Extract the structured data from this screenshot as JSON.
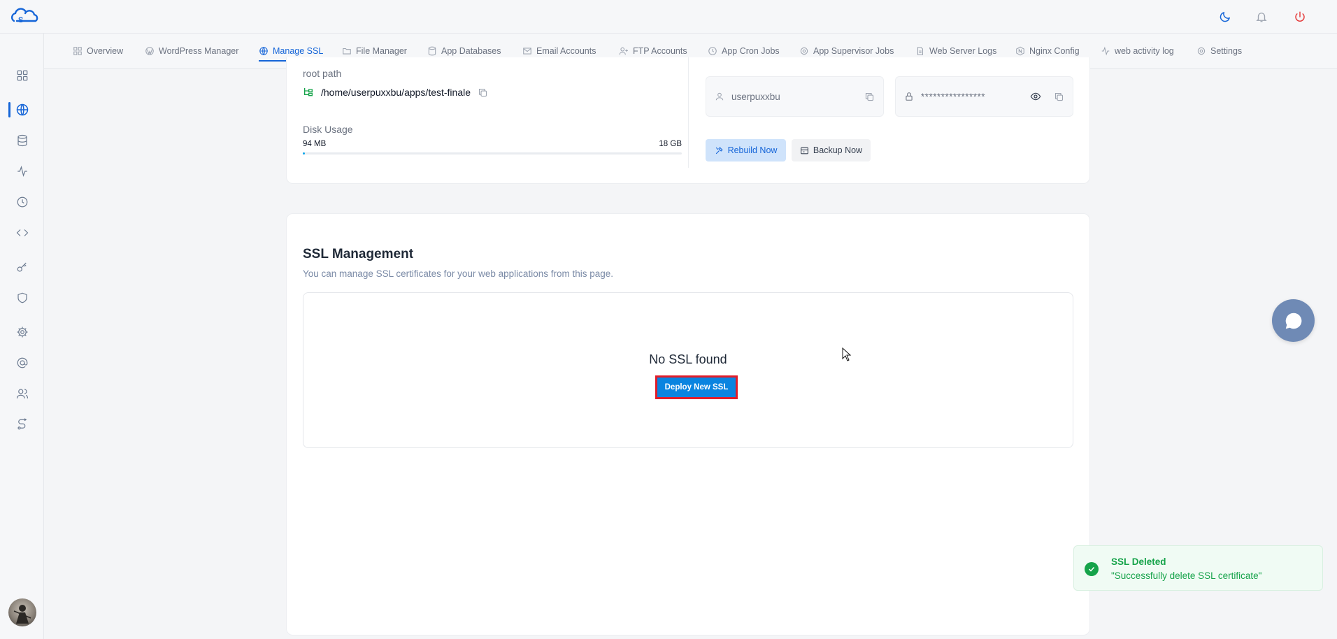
{
  "topbar": {
    "logo_icon": "cloud-logo-icon",
    "theme_icon": "moon-icon",
    "notification_icon": "bell-icon",
    "power_icon": "power-icon",
    "colors": {
      "accent": "#1565d8",
      "power": "#e53e3e"
    }
  },
  "sidebar": {
    "items": [
      {
        "icon": "dashboard-icon"
      },
      {
        "icon": "globe-icon",
        "active": true
      },
      {
        "icon": "database-icon"
      },
      {
        "icon": "activity-icon"
      },
      {
        "icon": "clock-icon"
      },
      {
        "icon": "code-icon"
      },
      {
        "icon": "key-icon"
      },
      {
        "icon": "shield-icon"
      },
      {
        "icon": "settings-gear-icon"
      },
      {
        "icon": "at-sign-icon"
      },
      {
        "icon": "users-icon"
      },
      {
        "icon": "route-icon"
      }
    ]
  },
  "tabs": [
    {
      "label": "Overview",
      "icon": "grid-icon"
    },
    {
      "label": "WordPress Manager",
      "icon": "wordpress-icon"
    },
    {
      "label": "Manage SSL",
      "icon": "globe-icon",
      "active": true
    },
    {
      "label": "File Manager",
      "icon": "folder-icon"
    },
    {
      "label": "App Databases",
      "icon": "database-icon"
    },
    {
      "label": "Email Accounts",
      "icon": "mail-icon"
    },
    {
      "label": "FTP Accounts",
      "icon": "user-plus-icon"
    },
    {
      "label": "App Cron Jobs",
      "icon": "clock-icon"
    },
    {
      "label": "App Supervisor Jobs",
      "icon": "cog-icon"
    },
    {
      "label": "Web Server Logs",
      "icon": "file-icon"
    },
    {
      "label": "Nginx Config",
      "icon": "nginx-icon"
    },
    {
      "label": "web activity log",
      "icon": "activity-icon"
    },
    {
      "label": "Settings",
      "icon": "gear-icon"
    }
  ],
  "app_info": {
    "root_path_label": "root path",
    "root_path": "/home/userpuxxbu/apps/test-finale",
    "disk_usage_label": "Disk Usage",
    "disk_used": "94 MB",
    "disk_total": "18 GB",
    "disk_fraction": 0.005,
    "username": "userpuxxbu",
    "password_masked": "****************",
    "rebuild_label": "Rebuild Now",
    "backup_label": "Backup Now"
  },
  "ssl": {
    "title": "SSL Management",
    "subtitle": "You can manage SSL certificates for your web applications from this page.",
    "empty_text": "No SSL found",
    "deploy_label": "Deploy New SSL"
  },
  "toast": {
    "title": "SSL Deleted",
    "message": "\"Successfully delete SSL certificate\"",
    "color": "#16a34a"
  },
  "chat_icon": "chat-bubble-icon"
}
